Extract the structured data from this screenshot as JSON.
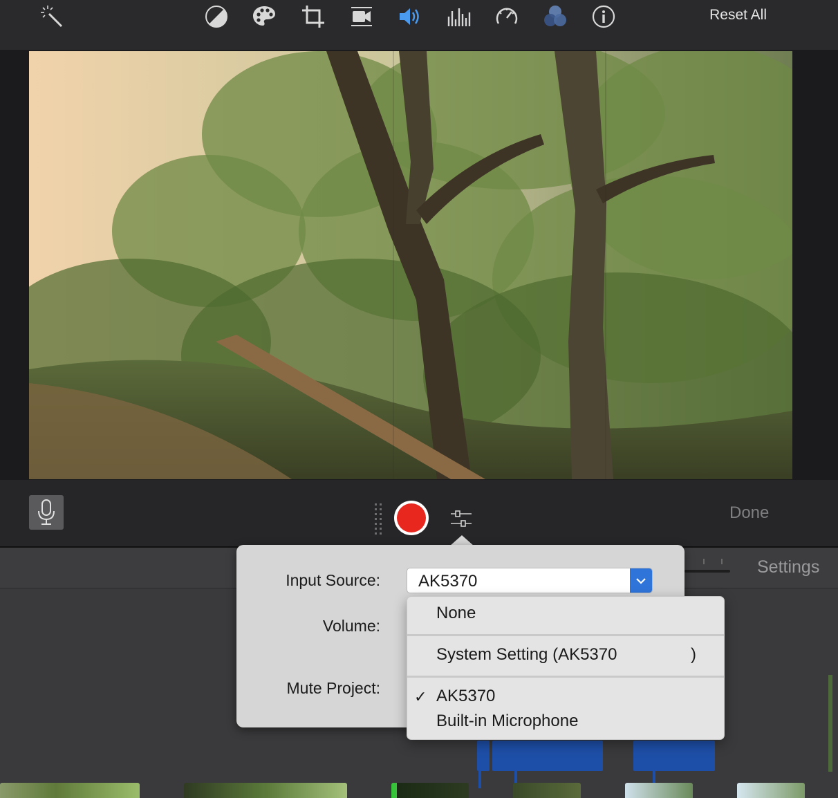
{
  "toolbar": {
    "icons": [
      "magic-wand-icon",
      "color-balance-icon",
      "color-palette-icon",
      "crop-icon",
      "stabilization-icon",
      "volume-icon",
      "equalizer-icon",
      "speed-icon",
      "filter-icon",
      "info-icon"
    ],
    "reset_all_label": "Reset All",
    "active_icon_color": "#4a9bf0",
    "icon_color": "#d8d8d8"
  },
  "record_controls": {
    "done_label": "Done",
    "record_color": "#e8281e"
  },
  "timeline": {
    "settings_label": "Settings",
    "clip_color": "#1e4fa8"
  },
  "record_popover": {
    "input_source_label": "Input Source:",
    "volume_label": "Volume:",
    "mute_project_label": "Mute Project:",
    "input_source_value": "AK5370",
    "dropdown_options": [
      {
        "label": "None",
        "checked": false
      },
      {
        "label": "System Setting (AK5370",
        "suffix": ")",
        "checked": false
      },
      {
        "label": "AK5370",
        "checked": true
      },
      {
        "label": "Built-in Microphone",
        "checked": false
      }
    ],
    "check_glyph": "✓",
    "accent": "#2f74d9"
  }
}
